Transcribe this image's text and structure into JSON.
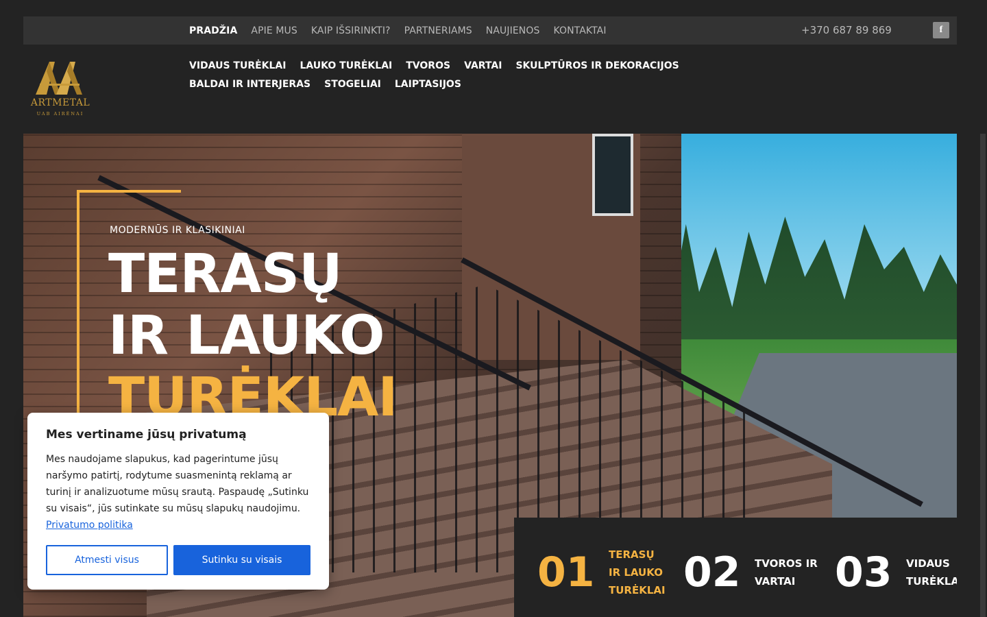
{
  "topbar": {
    "nav": [
      {
        "label": "PRADŽIA",
        "active": true
      },
      {
        "label": "APIE MUS"
      },
      {
        "label": "KAIP IŠSIRINKTI?"
      },
      {
        "label": "PARTNERIAMS"
      },
      {
        "label": "NAUJIENOS"
      },
      {
        "label": "KONTAKTAI"
      }
    ],
    "phone": "+370 687 89 869",
    "social_icon": "facebook-icon",
    "social_glyph": "f"
  },
  "logo": {
    "brand": "ARTMETAL",
    "subtitle": "UAB AIRĖNAI"
  },
  "mainnav": [
    "VIDAUS TURĖKLAI",
    "LAUKO TURĖKLAI",
    "TVOROS",
    "VARTAI",
    "SKULPTŪROS IR DEKORACIJOS",
    "BALDAI IR INTERJERAS",
    "STOGELIAI",
    "LAIPTASIJOS"
  ],
  "hero": {
    "eyebrow": "MODERNŪS IR KLASIKINIAI",
    "title_line1": "TERASŲ",
    "title_line2": "IR LAUKO",
    "title_accent": "TURĖKLAI"
  },
  "features": [
    {
      "num": "01",
      "label_lines": [
        "TERASŲ",
        "IR LAUKO",
        "TURĖKLAI"
      ],
      "highlighted": true
    },
    {
      "num": "02",
      "label_lines": [
        "TVOROS IR",
        "VARTAI"
      ]
    },
    {
      "num": "03",
      "label_lines": [
        "VIDAUS",
        "TURĖKLAI"
      ]
    }
  ],
  "cookie": {
    "title": "Mes vertiname jūsų privatumą",
    "text": "Mes naudojame slapukus, kad pagerintume jūsų naršymo patirtį, rodytume suasmenintą reklamą ar turinį ir analizuotume mūsų srautą. Paspaudę „Sutinku su visais“, jūs sutinkate su mūsų slapukų naudojimu.",
    "policy_link": "Privatumo politika",
    "reject_label": "Atmesti visus",
    "accept_label": "Sutinku su visais"
  },
  "colors": {
    "accent": "#f5b342",
    "background": "#232323",
    "topbar": "#333333",
    "cookie_button": "#1863dc"
  }
}
